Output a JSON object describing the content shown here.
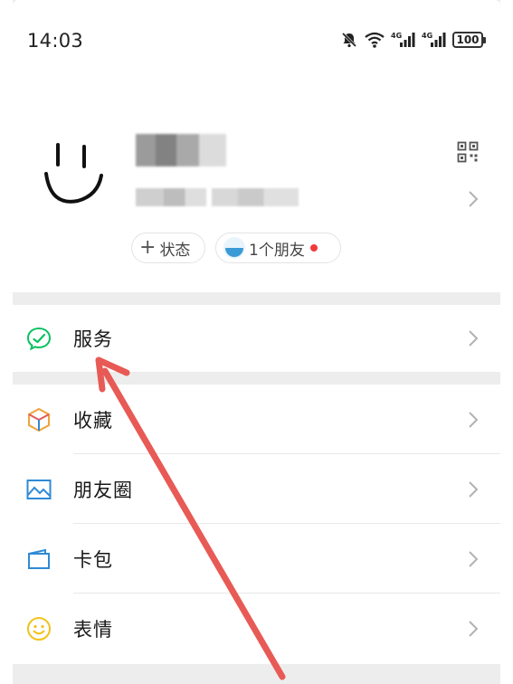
{
  "status_bar": {
    "time": "14:03",
    "battery": "100",
    "network_1": "4G",
    "network_2": "4G"
  },
  "profile": {
    "status_chip_label": "状态",
    "status_chip_plus": "+",
    "friends_chip_label": "1个朋友"
  },
  "menu": {
    "group1": [
      {
        "label": "服务",
        "icon": "service-icon",
        "color": "#07c160"
      }
    ],
    "group2": [
      {
        "label": "收藏",
        "icon": "favorites-cube-icon",
        "color": "#f0a33a"
      },
      {
        "label": "朋友圈",
        "icon": "moments-picture-icon",
        "color": "#2f8ad6"
      },
      {
        "label": "卡包",
        "icon": "card-wallet-icon",
        "color": "#2f8ad6"
      },
      {
        "label": "表情",
        "icon": "sticker-smile-icon",
        "color": "#f2c21b"
      }
    ]
  },
  "colors": {
    "page_bg": "#ededed",
    "annotation_arrow": "#e85a55",
    "notification_dot": "#f03a3a"
  }
}
